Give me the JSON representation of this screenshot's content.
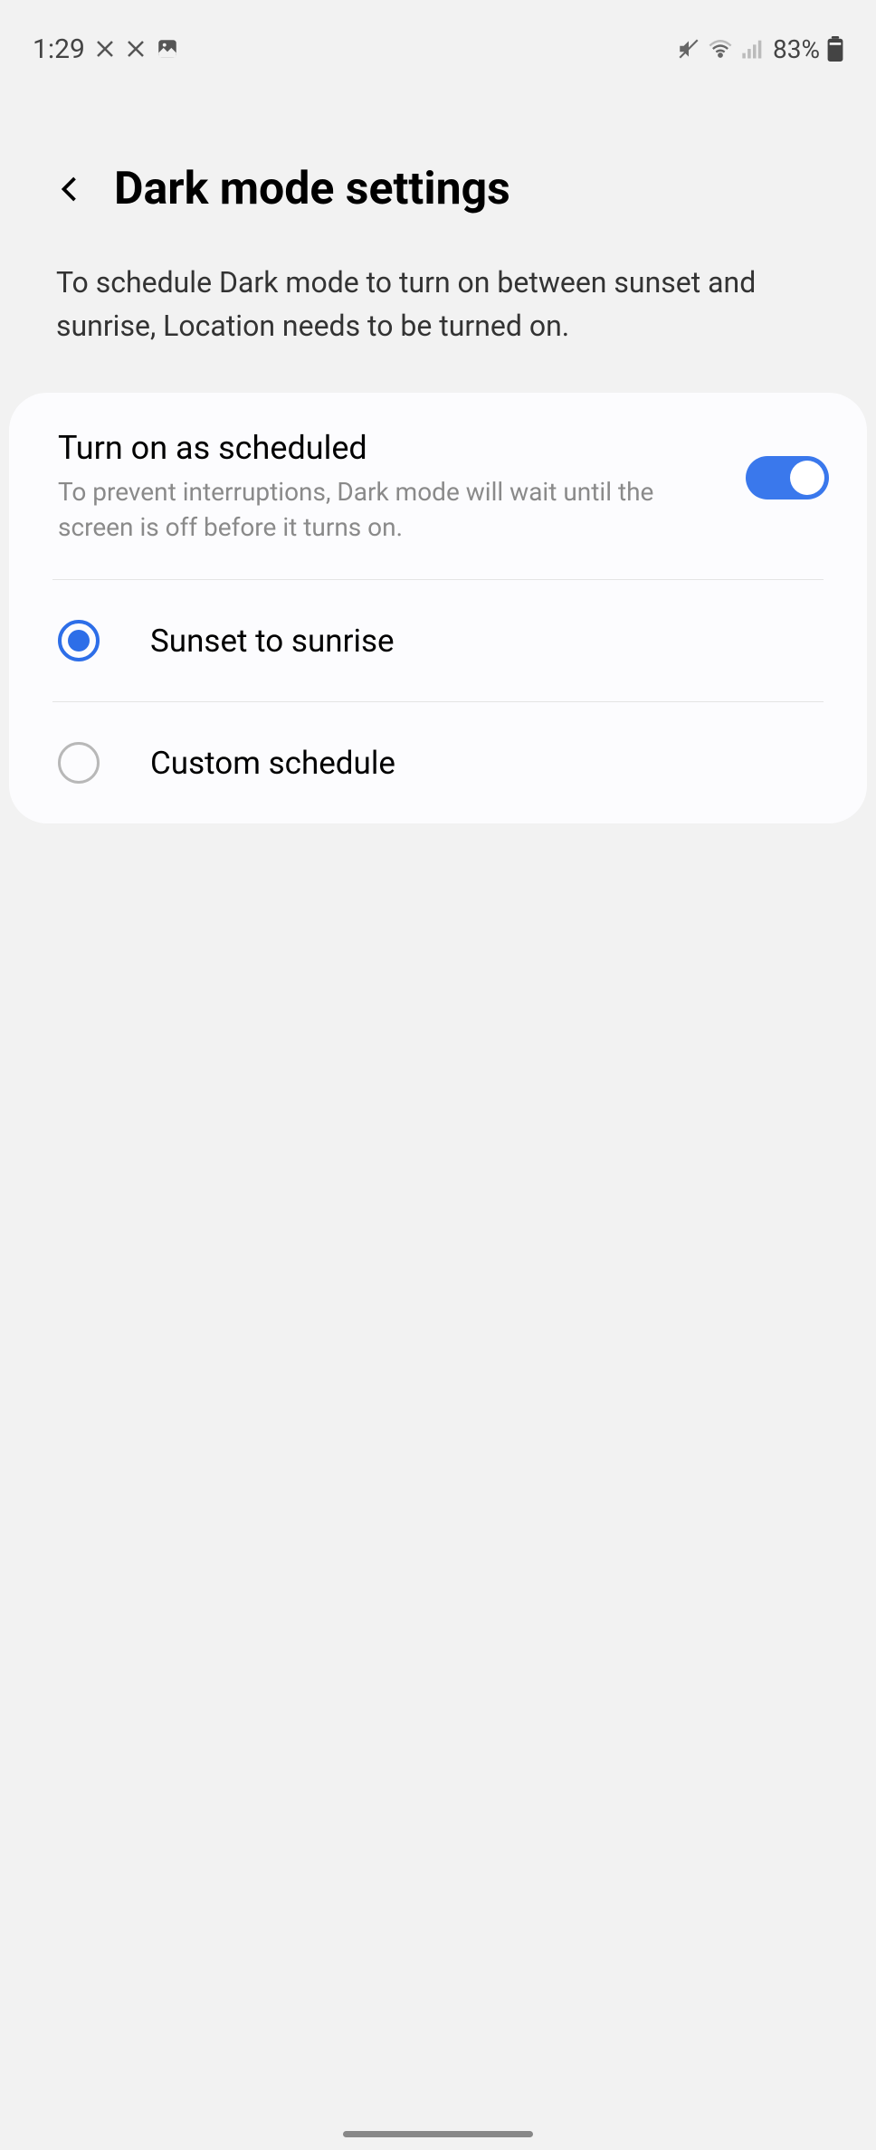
{
  "statusBar": {
    "time": "1:29",
    "batteryText": "83%"
  },
  "header": {
    "title": "Dark mode settings"
  },
  "description": "To schedule Dark mode to turn on between sunset and sunrise, Location needs to be turned on.",
  "scheduled": {
    "title": "Turn on as scheduled",
    "subtitle": "To prevent interruptions, Dark mode will wait until the screen is off before it turns on."
  },
  "options": {
    "sunset": "Sunset to sunrise",
    "custom": "Custom schedule"
  }
}
